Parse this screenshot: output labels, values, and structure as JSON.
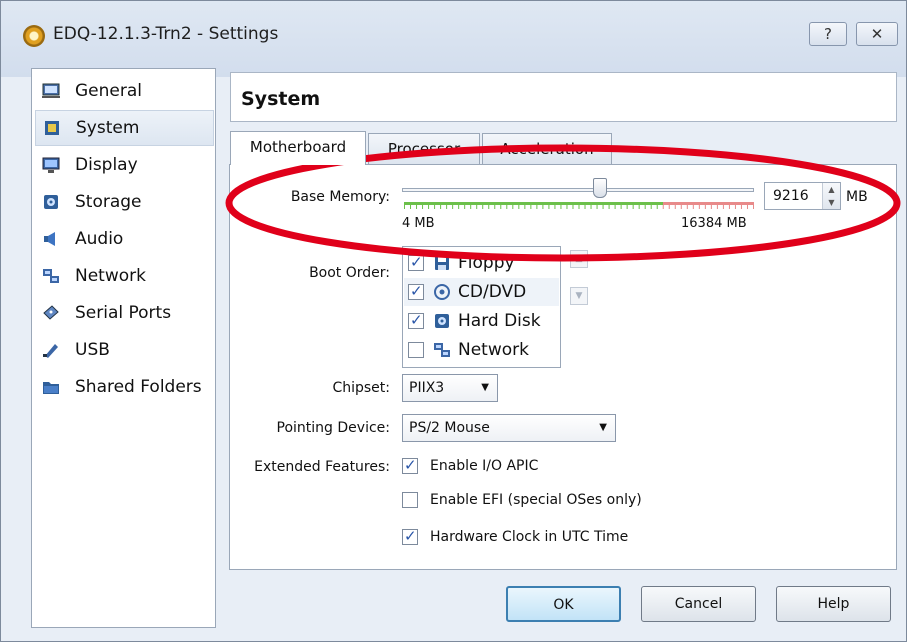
{
  "window": {
    "title": "EDQ-12.1.3-Trn2 - Settings",
    "help_glyph": "?",
    "close_glyph": "✕"
  },
  "sidebar": {
    "items": [
      {
        "label": "General",
        "icon": "computer-icon"
      },
      {
        "label": "System",
        "icon": "chip-icon",
        "selected": true
      },
      {
        "label": "Display",
        "icon": "monitor-icon"
      },
      {
        "label": "Storage",
        "icon": "disk-icon"
      },
      {
        "label": "Audio",
        "icon": "speaker-icon"
      },
      {
        "label": "Network",
        "icon": "network-icon"
      },
      {
        "label": "Serial Ports",
        "icon": "serial-icon"
      },
      {
        "label": "USB",
        "icon": "usb-icon"
      },
      {
        "label": "Shared Folders",
        "icon": "folder-icon"
      }
    ]
  },
  "page": {
    "title": "System",
    "tabs": [
      "Motherboard",
      "Processor",
      "Acceleration"
    ],
    "active_tab": "Motherboard"
  },
  "motherboard": {
    "base_memory_label": "Base Memory:",
    "memory_min_label": "4 MB",
    "memory_max_label": "16384 MB",
    "memory_value": "9216",
    "memory_unit": "MB",
    "memory_fraction": 0.5625,
    "boot_order_label": "Boot Order:",
    "boot_items": [
      {
        "label": "Floppy",
        "checked": true,
        "icon": "floppy-icon"
      },
      {
        "label": "CD/DVD",
        "checked": true,
        "icon": "cd-icon"
      },
      {
        "label": "Hard Disk",
        "checked": true,
        "icon": "hard-disk-icon"
      },
      {
        "label": "Network",
        "checked": false,
        "icon": "network-icon"
      }
    ],
    "chipset_label": "Chipset:",
    "chipset_value": "PIIX3",
    "pointing_label": "Pointing Device:",
    "pointing_value": "PS/2 Mouse",
    "extended_label": "Extended Features:",
    "features": [
      {
        "label": "Enable I/O APIC",
        "checked": true
      },
      {
        "label": "Enable EFI (special OSes only)",
        "checked": false
      },
      {
        "label": "Hardware Clock in UTC Time",
        "checked": true
      }
    ]
  },
  "buttons": {
    "ok": "OK",
    "cancel": "Cancel",
    "help": "Help"
  },
  "colors": {
    "annotation": "#e0001a",
    "slider_green": "#6cc04a",
    "slider_red": "#e88a8a"
  }
}
